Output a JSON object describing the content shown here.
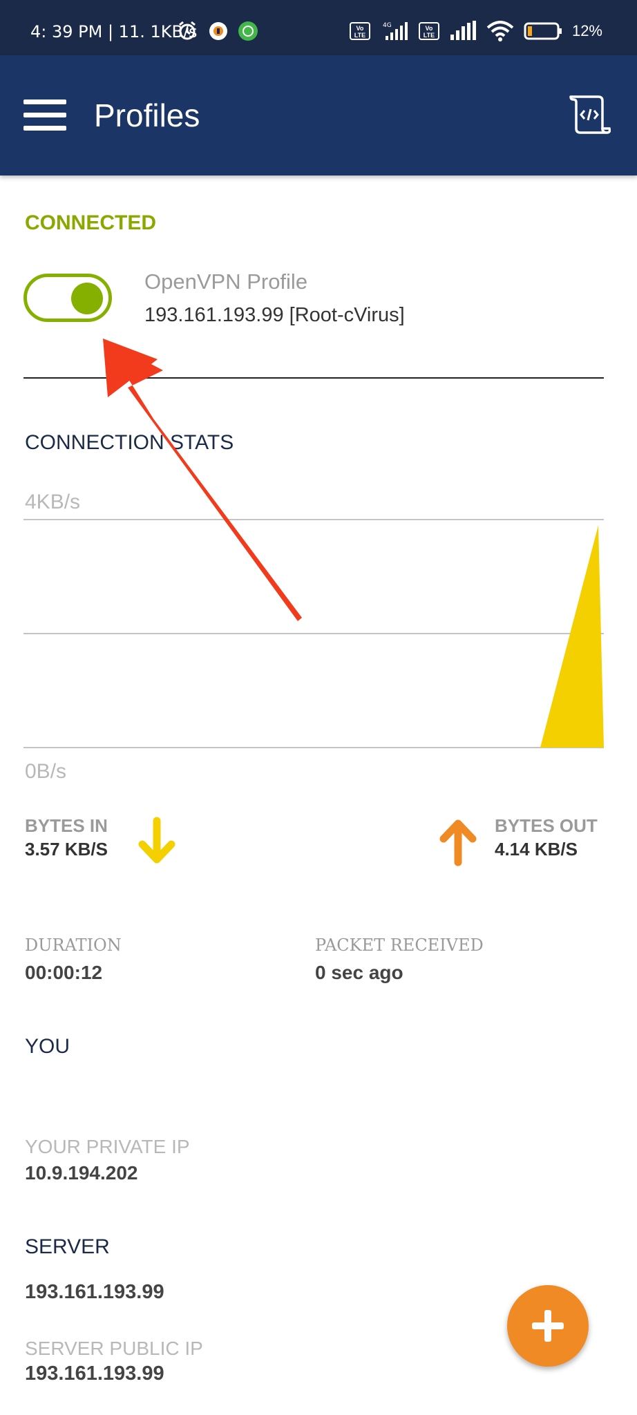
{
  "status_bar": {
    "time": "4: 39 PM | 11. 1KB/s",
    "battery": "12%",
    "network": "4G"
  },
  "header": {
    "title": "Profiles",
    "bg_color": "#1b3567"
  },
  "connection": {
    "status": "CONNECTED",
    "status_color": "#8aa800",
    "toggle_on": true,
    "profile_name": "OpenVPN Profile",
    "profile_server": "193.161.193.99 [Root-cVirus]"
  },
  "stats": {
    "title": "CONNECTION STATS",
    "bytes_in_label": "BYTES IN",
    "bytes_in_value": "3.57 KB/S",
    "bytes_out_label": "BYTES OUT",
    "bytes_out_value": "4.14 KB/S",
    "duration_label": "DURATION",
    "duration_value": "00:00:12",
    "packet_label": "PACKET RECEIVED",
    "packet_value": "0 sec ago"
  },
  "chart_data": {
    "type": "area",
    "y_top_label": "4KB/s",
    "y_bottom_label": "0B/s",
    "ylim": [
      0,
      4
    ],
    "series": [
      {
        "color": "#f5d000",
        "values": [
          0,
          0,
          0,
          0,
          0,
          0,
          0,
          0,
          0,
          0,
          0,
          0,
          3.9
        ]
      }
    ],
    "grid": true
  },
  "you": {
    "title": "YOU",
    "private_ip_label": "YOUR PRIVATE IP",
    "private_ip": "10.9.194.202"
  },
  "server": {
    "title": "SERVER",
    "address": "193.161.193.99",
    "public_ip_label": "SERVER PUBLIC IP",
    "public_ip": "193.161.193.99"
  },
  "colors": {
    "accent_green": "#86b000",
    "fab_orange": "#f08a24",
    "arrow_in": "#f5d000",
    "arrow_out": "#f08a24",
    "annotation_red": "#f23b1c"
  }
}
